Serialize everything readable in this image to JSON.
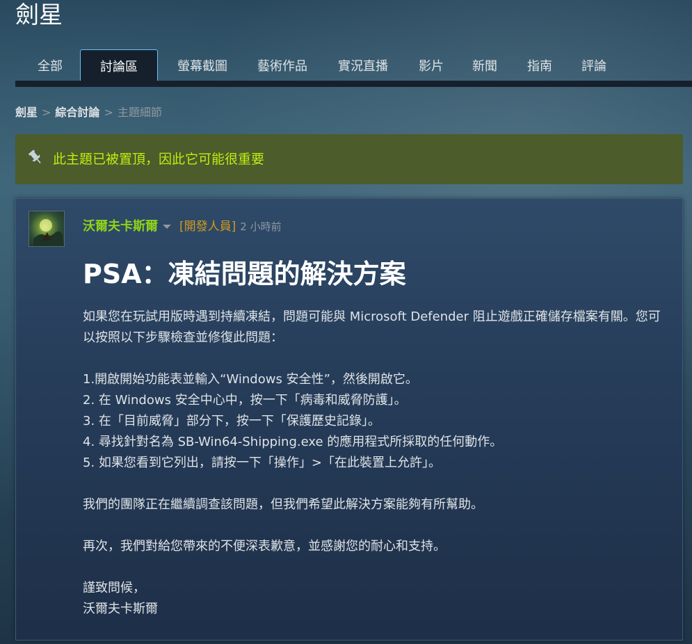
{
  "app": {
    "title": "劍星"
  },
  "tabs": [
    {
      "label": "全部"
    },
    {
      "label": "討論區"
    },
    {
      "label": "螢幕截圖"
    },
    {
      "label": "藝術作品"
    },
    {
      "label": "實況直播"
    },
    {
      "label": "影片"
    },
    {
      "label": "新聞"
    },
    {
      "label": "指南"
    },
    {
      "label": "評論"
    }
  ],
  "active_tab": "討論區",
  "breadcrumb": {
    "items": [
      "劍星",
      "綜合討論",
      "主題細節"
    ],
    "separator": ">"
  },
  "sticky_banner": {
    "icon": "pin-icon",
    "message": "此主題已被置頂，因此它可能很重要"
  },
  "post": {
    "author": "沃爾夫卡斯爾",
    "badge": "[開發人員]",
    "timestamp": "2 小時前",
    "title": "PSA：凍結問題的解決方案",
    "paragraphs": [
      "如果您在玩試用版時遇到持續凍結，問題可能與 Microsoft Defender 阻止遊戲正確儲存檔案有關。您可以按照以下步驟檢查並修復此問題：",
      "",
      "1.開啟開始功能表並輸入“Windows 安全性”，然後開啟它。",
      "2. 在 Windows 安全中心中，按一下「病毒和威脅防護」。",
      "3. 在「目前威脅」部分下，按一下「保護歷史記錄」。",
      "4. 尋找針對名為 SB-Win64-Shipping.exe 的應用程式所採取的任何動作。",
      "5. 如果您看到它列出，請按一下「操作」>「在此裝置上允許」。",
      "",
      "我們的團隊正在繼續調查該問題，但我們希望此解決方案能夠有所幫助。",
      "",
      "再次，我們對給您帶來的不便深表歉意，並感謝您的耐心和支持。",
      "",
      "謹致問候，",
      "沃爾夫卡斯爾"
    ]
  },
  "colors": {
    "author": "#8fd21a",
    "developer_badge": "#d29b1e",
    "banner_bg": "#4c5c2b",
    "banner_text": "#beee11",
    "active_tab_border": "#67c1f5"
  }
}
